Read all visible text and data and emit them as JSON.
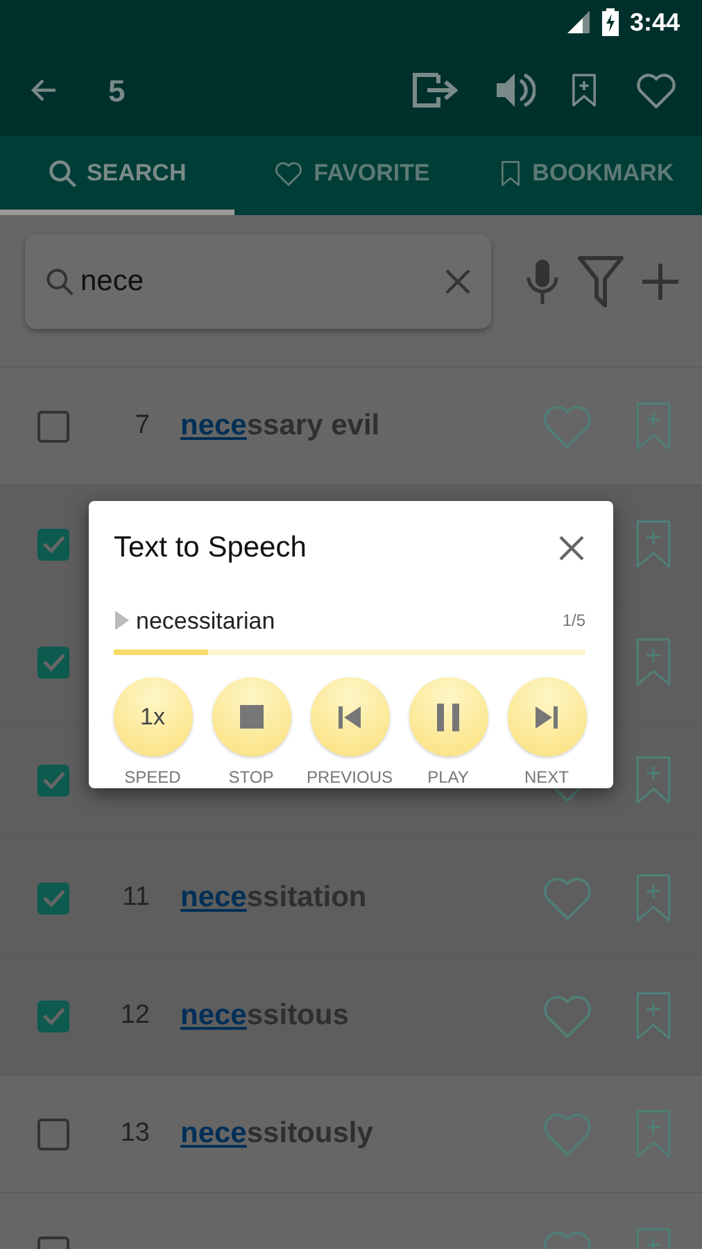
{
  "status_bar": {
    "time": "3:44"
  },
  "toolbar": {
    "count": "5"
  },
  "tabs": [
    {
      "kind": "search",
      "label": "SEARCH",
      "selected": true
    },
    {
      "kind": "favorite",
      "label": "FAVORITE",
      "selected": false
    },
    {
      "kind": "bookmark",
      "label": "BOOKMARK",
      "selected": false
    }
  ],
  "search": {
    "value": "nece"
  },
  "rows": [
    {
      "number": "7",
      "highlight": "nece",
      "rest": "ssary evil",
      "checked": false
    },
    {
      "checked": true
    },
    {
      "checked": true
    },
    {
      "checked": true
    },
    {
      "number": "11",
      "highlight": "nece",
      "rest": "ssitation",
      "checked": true
    },
    {
      "number": "12",
      "highlight": "nece",
      "rest": "ssitous",
      "checked": true
    },
    {
      "number": "13",
      "highlight": "nece",
      "rest": "ssitously",
      "checked": false
    },
    {
      "checked": false
    }
  ],
  "dialog": {
    "title": "Text to Speech",
    "word": "necessitarian",
    "counter": "1/5",
    "level": 0.2,
    "controls": [
      {
        "kind": "speed",
        "text": "1x",
        "label": "SPEED"
      },
      {
        "kind": "stop",
        "label": "STOP"
      },
      {
        "kind": "previous",
        "label": "PREVIOUS"
      },
      {
        "kind": "pause",
        "label": "PLAY"
      },
      {
        "kind": "next",
        "label": "NEXT"
      }
    ]
  }
}
